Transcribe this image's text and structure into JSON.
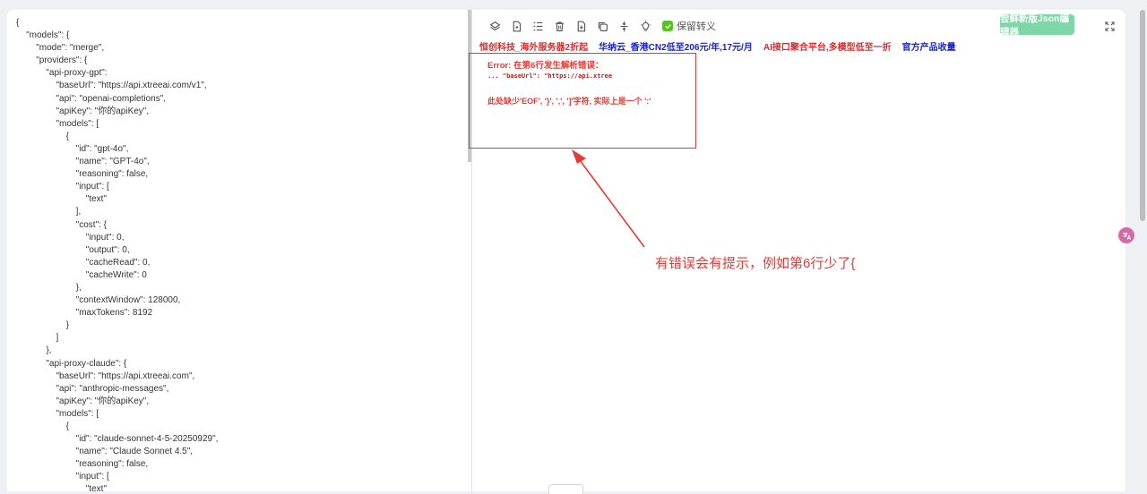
{
  "editor": {
    "lines": [
      "{",
      "    \"models\": {",
      "        \"mode\": \"merge\",",
      "        \"providers\": {",
      "            \"api-proxy-gpt\":",
      "                \"baseUrl\": \"https://api.xtreeai.com/v1\",",
      "                \"api\": \"openai-completions\",",
      "                \"apiKey\": \"你的apiKey\",",
      "                \"models\": [",
      "                    {",
      "                        \"id\": \"gpt-4o\",",
      "                        \"name\": \"GPT-4o\",",
      "                        \"reasoning\": false,",
      "                        \"input\": [",
      "                            \"text\"",
      "                        ],",
      "                        \"cost\": {",
      "                            \"input\": 0,",
      "                            \"output\": 0,",
      "                            \"cacheRead\": 0,",
      "                            \"cacheWrite\": 0",
      "                        },",
      "                        \"contextWindow\": 128000,",
      "                        \"maxTokens\": 8192",
      "                    }",
      "                ]",
      "            },",
      "            \"api-proxy-claude\": {",
      "                \"baseUrl\": \"https://api.xtreeai.com\",",
      "                \"api\": \"anthropic-messages\",",
      "                \"apiKey\": \"你的apiKey\",",
      "                \"models\": [",
      "                    {",
      "                        \"id\": \"claude-sonnet-4-5-20250929\",",
      "                        \"name\": \"Claude Sonnet 4.5\",",
      "                        \"reasoning\": false,",
      "                        \"input\": [",
      "                            \"text\""
    ]
  },
  "toolbar": {
    "keep_escape_label": "保留转义",
    "new_editor_label": "尝鲜新版Json编辑器",
    "icons": [
      "layers-icon",
      "file-icon",
      "list-icon",
      "trash-icon",
      "file-download-icon",
      "copy-icon",
      "compress-icon",
      "bulb-icon"
    ]
  },
  "ads": [
    {
      "text": "恒创科技_海外服务器2折起",
      "color": "#d32f2f"
    },
    {
      "text": "华纳云_香港CN2低至206元/年,17元/月",
      "color": "#1a23c9"
    },
    {
      "text": "AI接口聚合平台,多模型低至一折",
      "color": "#d32f2f"
    },
    {
      "text": "官方产品收量",
      "color": "#1a23c9"
    }
  ],
  "error": {
    "title": "Error: 在第6行发生解析错误：",
    "snippet": "... \"baseUrl\": \"https://api.xtree",
    "detail": "此处缺少'EOF', '}', ',', ']'字符, 实际上是一个 ':'"
  },
  "annotation": {
    "text": "有错误会有提示，例如第6行少了{"
  },
  "colors": {
    "error_red": "#e53935",
    "accent_green": "#7fd6a6",
    "checkbox_green": "#52c41a"
  }
}
